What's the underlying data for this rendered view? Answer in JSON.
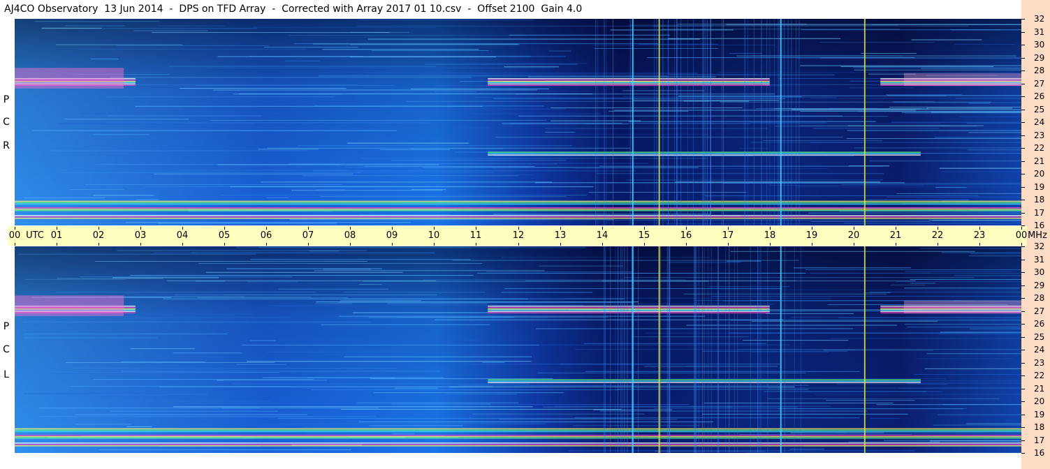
{
  "title": "AJ4CO Observatory  13 Jun 2014  -  DPS on TFD Array  -  Corrected with Array 2017 01 10.csv  -  Offset 2100  Gain 4.0",
  "colors": {
    "background": "#ffffff",
    "time_band": "#ffffc0",
    "freq_strip": "#fcdcc4",
    "spectrogram_low": "#050a3c",
    "spectrogram_mid": "#1a64e6",
    "spectrogram_high": "#ffffff"
  },
  "chart_data": [
    {
      "type": "heatmap",
      "panel": "top",
      "polarization_label": [
        "R",
        "C",
        "P"
      ],
      "x_axis": {
        "ticks": [
          "00",
          "01",
          "02",
          "03",
          "04",
          "05",
          "06",
          "07",
          "08",
          "09",
          "10",
          "11",
          "12",
          "13",
          "14",
          "15",
          "16",
          "17",
          "18",
          "19",
          "20",
          "21",
          "22",
          "23",
          "00"
        ],
        "unit_label_left": "UTC",
        "unit_label_right": "MHz",
        "range": [
          0,
          24
        ]
      },
      "y_axis": {
        "ticks": [
          16,
          17,
          18,
          19,
          20,
          21,
          22,
          23,
          24,
          25,
          26,
          27,
          28,
          29,
          30,
          31,
          32
        ],
        "range": [
          16,
          32
        ]
      },
      "colormap": "spectral (dark blue = low, white = high)",
      "features": {
        "bright_bands_mhz": [
          16.7,
          17.3,
          17.8,
          21.6,
          27.0,
          27.3
        ],
        "vertical_lines_utc": [
          14.72,
          15.35,
          18.25,
          20.25
        ]
      }
    },
    {
      "type": "heatmap",
      "panel": "bottom",
      "polarization_label": [
        "L",
        "C",
        "P"
      ],
      "x_axis": {
        "ticks": [
          "00",
          "01",
          "02",
          "03",
          "04",
          "05",
          "06",
          "07",
          "08",
          "09",
          "10",
          "11",
          "12",
          "13",
          "14",
          "15",
          "16",
          "17",
          "18",
          "19",
          "20",
          "21",
          "22",
          "23",
          "00"
        ],
        "range": [
          0,
          24
        ]
      },
      "y_axis": {
        "ticks": [
          16,
          17,
          18,
          19,
          20,
          21,
          22,
          23,
          24,
          25,
          26,
          27,
          28,
          29,
          30,
          31,
          32
        ],
        "range": [
          16,
          32
        ]
      },
      "colormap": "spectral (dark blue = low, white = high)",
      "features": {
        "bright_bands_mhz": [
          16.7,
          17.3,
          17.8,
          21.6,
          27.0,
          27.3
        ],
        "vertical_lines_utc": [
          14.72,
          15.35,
          18.25,
          20.25
        ]
      }
    }
  ]
}
